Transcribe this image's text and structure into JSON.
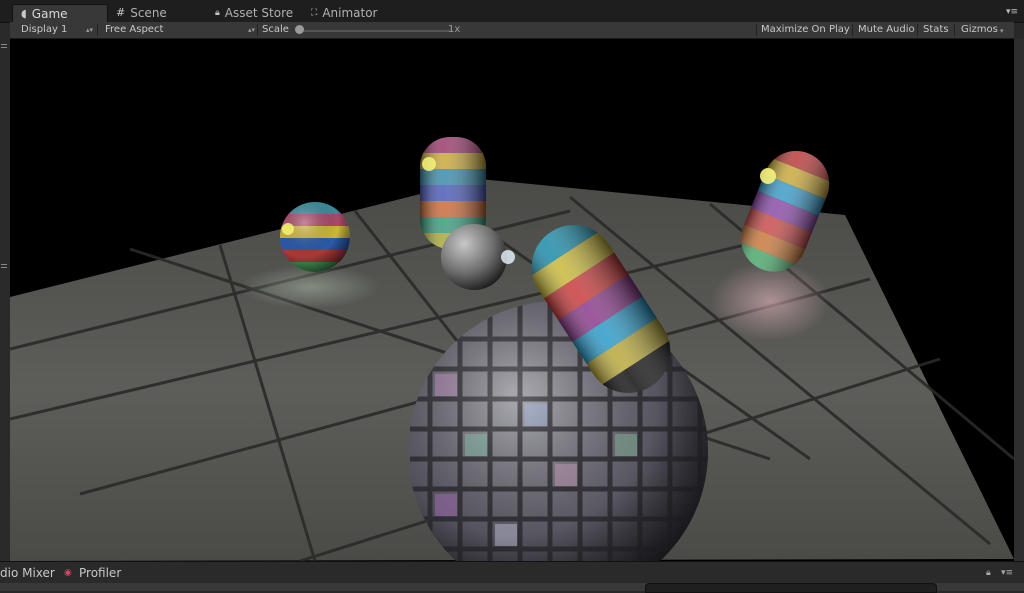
{
  "tabs": [
    {
      "label": "Game",
      "icon": "pacman-icon",
      "active": true
    },
    {
      "label": "Scene",
      "icon": "grid-icon",
      "active": false
    },
    {
      "label": "Asset Store",
      "icon": "lock-icon",
      "active": false
    },
    {
      "label": "Animator",
      "icon": "animator-icon",
      "active": false
    }
  ],
  "toolbar": {
    "display": "Display 1",
    "aspect": "Free Aspect",
    "scale_label": "Scale",
    "scale_value": "1x",
    "maximize": "Maximize On Play",
    "mute": "Mute Audio",
    "stats": "Stats",
    "gizmos": "Gizmos"
  },
  "bottom_tabs": [
    {
      "label": "dio Mixer"
    },
    {
      "label": "Profiler",
      "icon": "profiler-icon"
    }
  ],
  "colors": {
    "accent_tab_bg": "#383838",
    "floor": "#5e5e5a",
    "viewport_bg": "#000000"
  }
}
